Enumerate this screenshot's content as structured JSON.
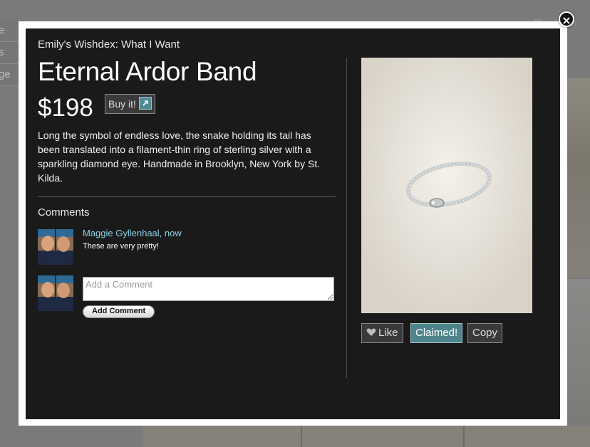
{
  "background": {
    "left_nav": [
      "e",
      "s",
      "ge"
    ],
    "top_right_text": "Sh… Wish"
  },
  "modal": {
    "close_label": "×",
    "list_title": "Emily's Wishdex: What I Want",
    "item_title": "Eternal Ardor Band",
    "price": "$198",
    "buy_label": "Buy it!",
    "description": " Long the symbol of endless love, the snake holding its tail has been translated into a filament-thin ring of sterling silver with a sparkling diamond eye. Handmade in Brooklyn, New York by St. Kilda.",
    "comments_heading": "Comments",
    "comments": [
      {
        "author": "Maggie Gyllenhaal, now",
        "text": "These are very pretty!"
      }
    ],
    "add_comment": {
      "placeholder": "Add a Comment",
      "button_label": "Add Comment"
    },
    "actions": {
      "like_label": "Like",
      "claimed_label": "Claimed!",
      "copy_label": "Copy"
    }
  },
  "icons": {
    "close": "close-icon",
    "external_link": "external-link-icon",
    "heart": "heart-icon"
  },
  "colors": {
    "modal_bg": "#1a1a1a",
    "claimed_accent": "#4e858c",
    "author_link": "#8fd3e6"
  }
}
